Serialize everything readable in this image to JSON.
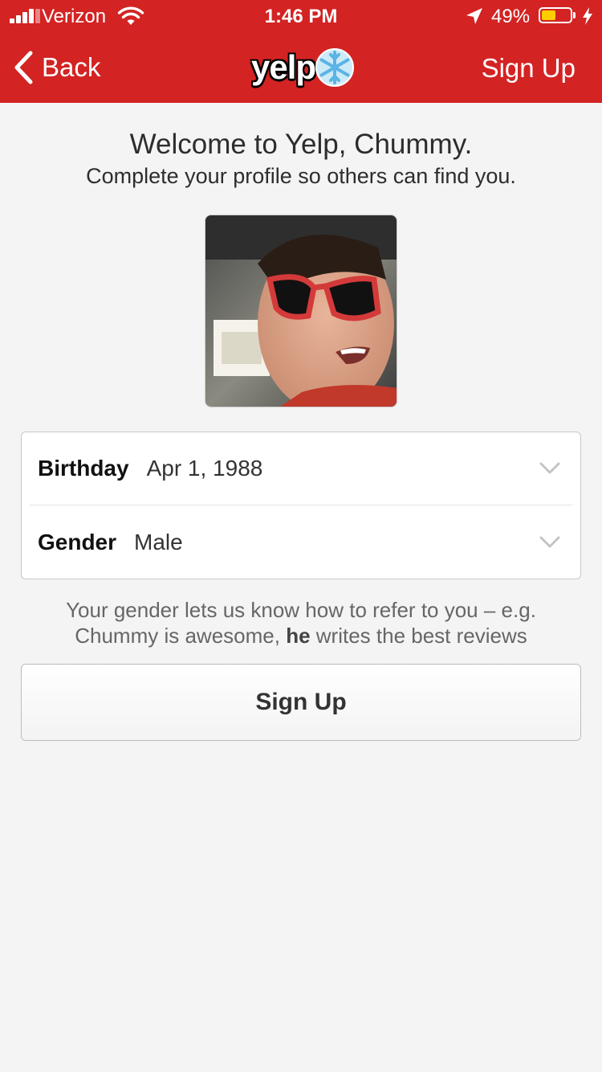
{
  "status_bar": {
    "carrier": "Verizon",
    "time": "1:46 PM",
    "battery_percent": "49%",
    "battery_level": 0.49,
    "battery_color": "#ffcc00"
  },
  "nav": {
    "back_label": "Back",
    "logo_text": "yelp",
    "signup_label": "Sign Up",
    "bar_color": "#d32323"
  },
  "welcome": {
    "title": "Welcome to Yelp, Chummy.",
    "subtitle": "Complete your profile so others can find you."
  },
  "profile_photo": {
    "icon": "profile-photo"
  },
  "form": {
    "birthday": {
      "label": "Birthday",
      "value": "Apr 1, 1988"
    },
    "gender": {
      "label": "Gender",
      "value": "Male"
    }
  },
  "helper": {
    "line1": "Your gender lets us know how to refer to you – e.g.",
    "line2_prefix": "Chummy is awesome, ",
    "line2_bold": "he",
    "line2_suffix": " writes the best reviews"
  },
  "signup_button": {
    "label": "Sign Up"
  }
}
